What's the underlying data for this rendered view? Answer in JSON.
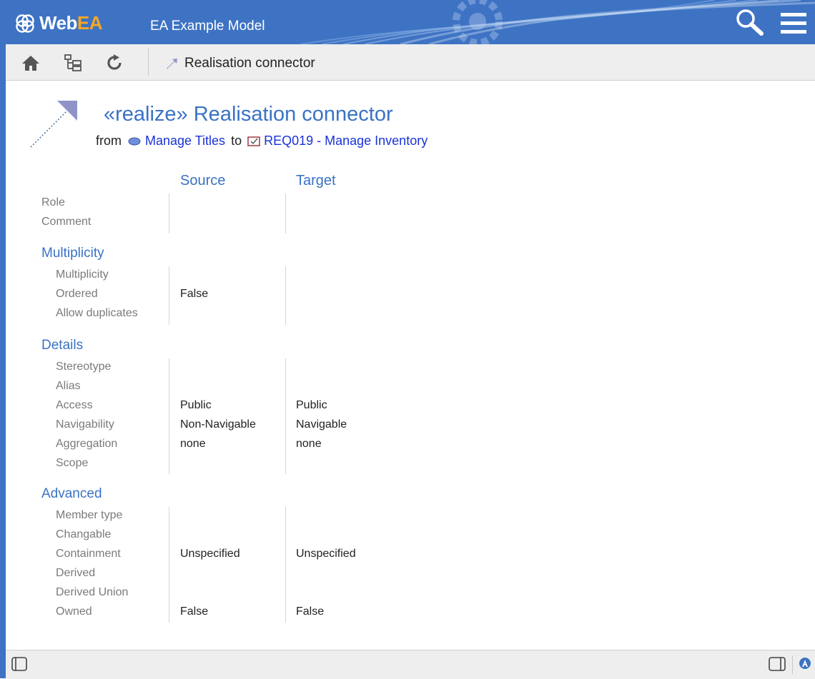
{
  "header": {
    "logo_prefix": "Web",
    "logo_suffix": "EA",
    "model_title": "EA Example Model"
  },
  "toolbar": {
    "breadcrumb": "Realisation connector"
  },
  "connector": {
    "title": "«realize» Realisation connector",
    "from_label": "from",
    "from_element": "Manage Titles",
    "to_label": "to",
    "to_element": "REQ019 - Manage Inventory"
  },
  "columns": {
    "source": "Source",
    "target": "Target"
  },
  "general": {
    "rows": [
      {
        "label": "Role",
        "source": "",
        "target": ""
      },
      {
        "label": "Comment",
        "source": "",
        "target": ""
      }
    ]
  },
  "multiplicity": {
    "heading": "Multiplicity",
    "rows": [
      {
        "label": "Multiplicity",
        "source": "",
        "target": ""
      },
      {
        "label": "Ordered",
        "source": "False",
        "target": ""
      },
      {
        "label": "Allow duplicates",
        "source": "",
        "target": ""
      }
    ]
  },
  "details": {
    "heading": "Details",
    "rows": [
      {
        "label": "Stereotype",
        "source": "",
        "target": ""
      },
      {
        "label": "Alias",
        "source": "",
        "target": ""
      },
      {
        "label": "Access",
        "source": "Public",
        "target": "Public"
      },
      {
        "label": "Navigability",
        "source": "Non-Navigable",
        "target": "Navigable"
      },
      {
        "label": "Aggregation",
        "source": "none",
        "target": "none"
      },
      {
        "label": "Scope",
        "source": "",
        "target": ""
      }
    ]
  },
  "advanced": {
    "heading": "Advanced",
    "rows": [
      {
        "label": "Member type",
        "source": "",
        "target": ""
      },
      {
        "label": "Changable",
        "source": "",
        "target": ""
      },
      {
        "label": "Containment",
        "source": "Unspecified",
        "target": "Unspecified"
      },
      {
        "label": "Derived",
        "source": "",
        "target": ""
      },
      {
        "label": "Derived Union",
        "source": "",
        "target": ""
      },
      {
        "label": "Owned",
        "source": "False",
        "target": "False"
      }
    ]
  },
  "icons": {
    "header": [
      "webea-logo-icon",
      "search-icon",
      "hamburger-menu-icon"
    ],
    "toolbar": [
      "home-icon",
      "browser-tree-icon",
      "refresh-icon",
      "realisation-connector-icon"
    ],
    "statusbar": [
      "left-panel-toggle-icon",
      "right-panel-toggle-icon",
      "user-avatar-icon"
    ]
  },
  "colors": {
    "header_bg": "#3e73c4",
    "logo_accent": "#f6a623",
    "heading_blue": "#3a72c5",
    "link_blue": "#1a32d8",
    "label_gray": "#7a7a7a"
  }
}
